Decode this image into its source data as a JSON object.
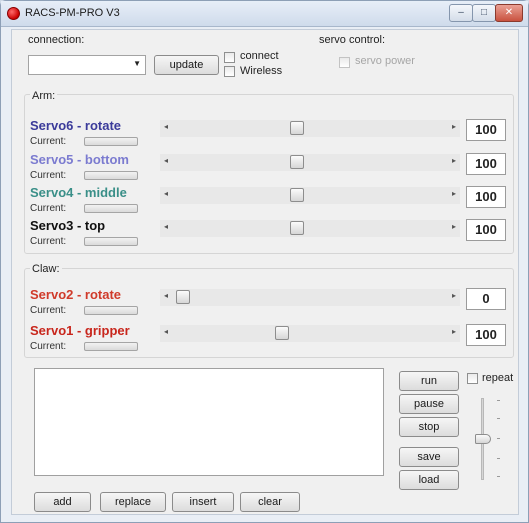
{
  "window": {
    "title": "RACS-PM-PRO V3",
    "minimize": "–",
    "maximize": "□",
    "close": "✕"
  },
  "connection": {
    "label": "connection:",
    "port_value": "",
    "update_label": "update",
    "connect_label": "connect",
    "wireless_label": "Wireless",
    "connect_checked": false,
    "wireless_checked": false
  },
  "servo_control": {
    "label": "servo control:",
    "servo_power_label": "servo power",
    "enabled": false
  },
  "arm": {
    "label": "Arm:",
    "servos": [
      {
        "name": "Servo6 - rotate",
        "color": "#3b3b9a",
        "current_label": "Current:",
        "value": "100",
        "position": 0.45
      },
      {
        "name": "Servo5 - bottom",
        "color": "#7b7bd0",
        "current_label": "Current:",
        "value": "100",
        "position": 0.45
      },
      {
        "name": "Servo4 - middle",
        "color": "#3a8f88",
        "current_label": "Current:",
        "value": "100",
        "position": 0.45
      },
      {
        "name": "Servo3 - top",
        "color": "#111111",
        "current_label": "Current:",
        "value": "100",
        "position": 0.45
      }
    ]
  },
  "claw": {
    "label": "Claw:",
    "servos": [
      {
        "name": "Servo2 - rotate",
        "color": "#d03a2a",
        "current_label": "Current:",
        "value": "0",
        "position": 0.0
      },
      {
        "name": "Servo1 - gripper",
        "color": "#c8261c",
        "current_label": "Current:",
        "value": "100",
        "position": 0.39
      }
    ]
  },
  "sequence": {
    "text": "",
    "buttons": {
      "run": "run",
      "pause": "pause",
      "stop": "stop",
      "save": "save",
      "load": "load",
      "add": "add",
      "replace": "replace",
      "insert": "insert",
      "clear": "clear"
    },
    "repeat_label": "repeat",
    "repeat_checked": false,
    "speed": 0.5
  },
  "colors": {
    "accent": "#3b3b9a",
    "claw": "#d03a2a"
  }
}
